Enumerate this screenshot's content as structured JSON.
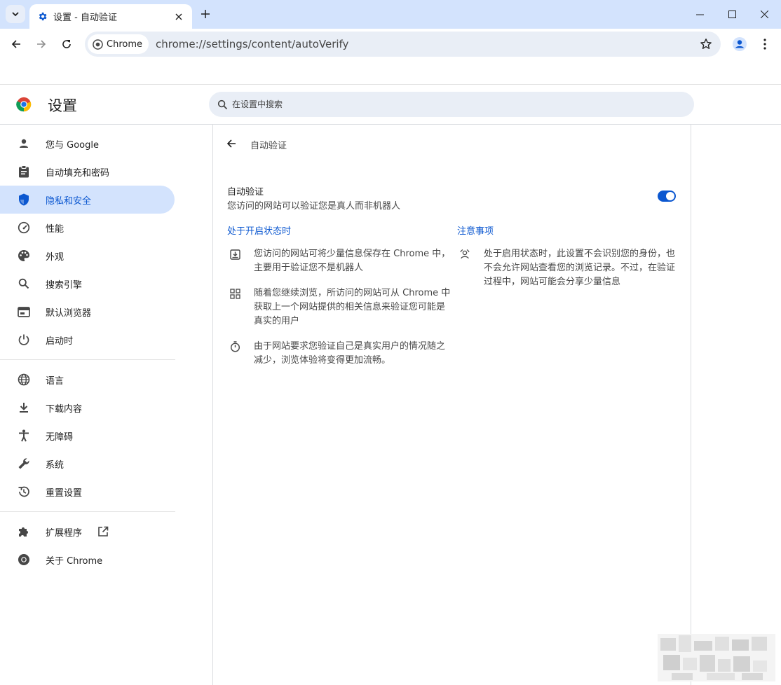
{
  "browser": {
    "tab_title": "设置 - 自动验证",
    "url_chip": "Chrome",
    "url": "chrome://settings/content/autoVerify"
  },
  "settings": {
    "title": "设置",
    "search_placeholder": "在设置中搜索"
  },
  "sidebar": {
    "items": [
      {
        "label": "您与 Google",
        "icon": "person-icon"
      },
      {
        "label": "自动填充和密码",
        "icon": "clipboard-icon"
      },
      {
        "label": "隐私和安全",
        "icon": "shield-icon",
        "active": true
      },
      {
        "label": "性能",
        "icon": "speedometer-icon"
      },
      {
        "label": "外观",
        "icon": "palette-icon"
      },
      {
        "label": "搜索引擎",
        "icon": "search-icon"
      },
      {
        "label": "默认浏览器",
        "icon": "browser-window-icon"
      },
      {
        "label": "启动时",
        "icon": "power-icon"
      },
      {
        "label": "语言",
        "icon": "globe-icon"
      },
      {
        "label": "下载内容",
        "icon": "download-icon"
      },
      {
        "label": "无障碍",
        "icon": "accessibility-icon"
      },
      {
        "label": "系统",
        "icon": "wrench-icon"
      },
      {
        "label": "重置设置",
        "icon": "history-icon"
      },
      {
        "label": "扩展程序",
        "icon": "puzzle-icon"
      },
      {
        "label": "关于 Chrome",
        "icon": "chrome-icon"
      }
    ]
  },
  "page": {
    "title": "自动验证",
    "toggle_label": "自动验证",
    "toggle_sublabel": "您访问的网站可以验证您是真人而非机器人",
    "toggle_on": true,
    "col_left_heading": "处于开启状态时",
    "col_right_heading": "注意事项",
    "left_items": [
      {
        "icon": "save-box-icon",
        "text": "您访问的网站可将少量信息保存在 Chrome 中，主要用于验证您不是机器人"
      },
      {
        "icon": "grid-icon",
        "text": "随着您继续浏览，所访问的网站可从 Chrome 中获取上一个网站提供的相关信息来验证您可能是真实的用户"
      },
      {
        "icon": "timer-icon",
        "text": "由于网站要求您验证自己是真实用户的情况随之减少，浏览体验将变得更加流畅。"
      }
    ],
    "right_items": [
      {
        "icon": "privacy-person-icon",
        "text": "处于启用状态时，此设置不会识别您的身份，也不会允许网站查看您的浏览记录。不过，在验证过程中，网站可能会分享少量信息"
      }
    ]
  },
  "colors": {
    "accent": "#0b57d0",
    "active_nav_bg": "#d3e3fd",
    "tabstrip_bg": "#d3e3fd",
    "omnibox_bg": "#e9eef6"
  }
}
